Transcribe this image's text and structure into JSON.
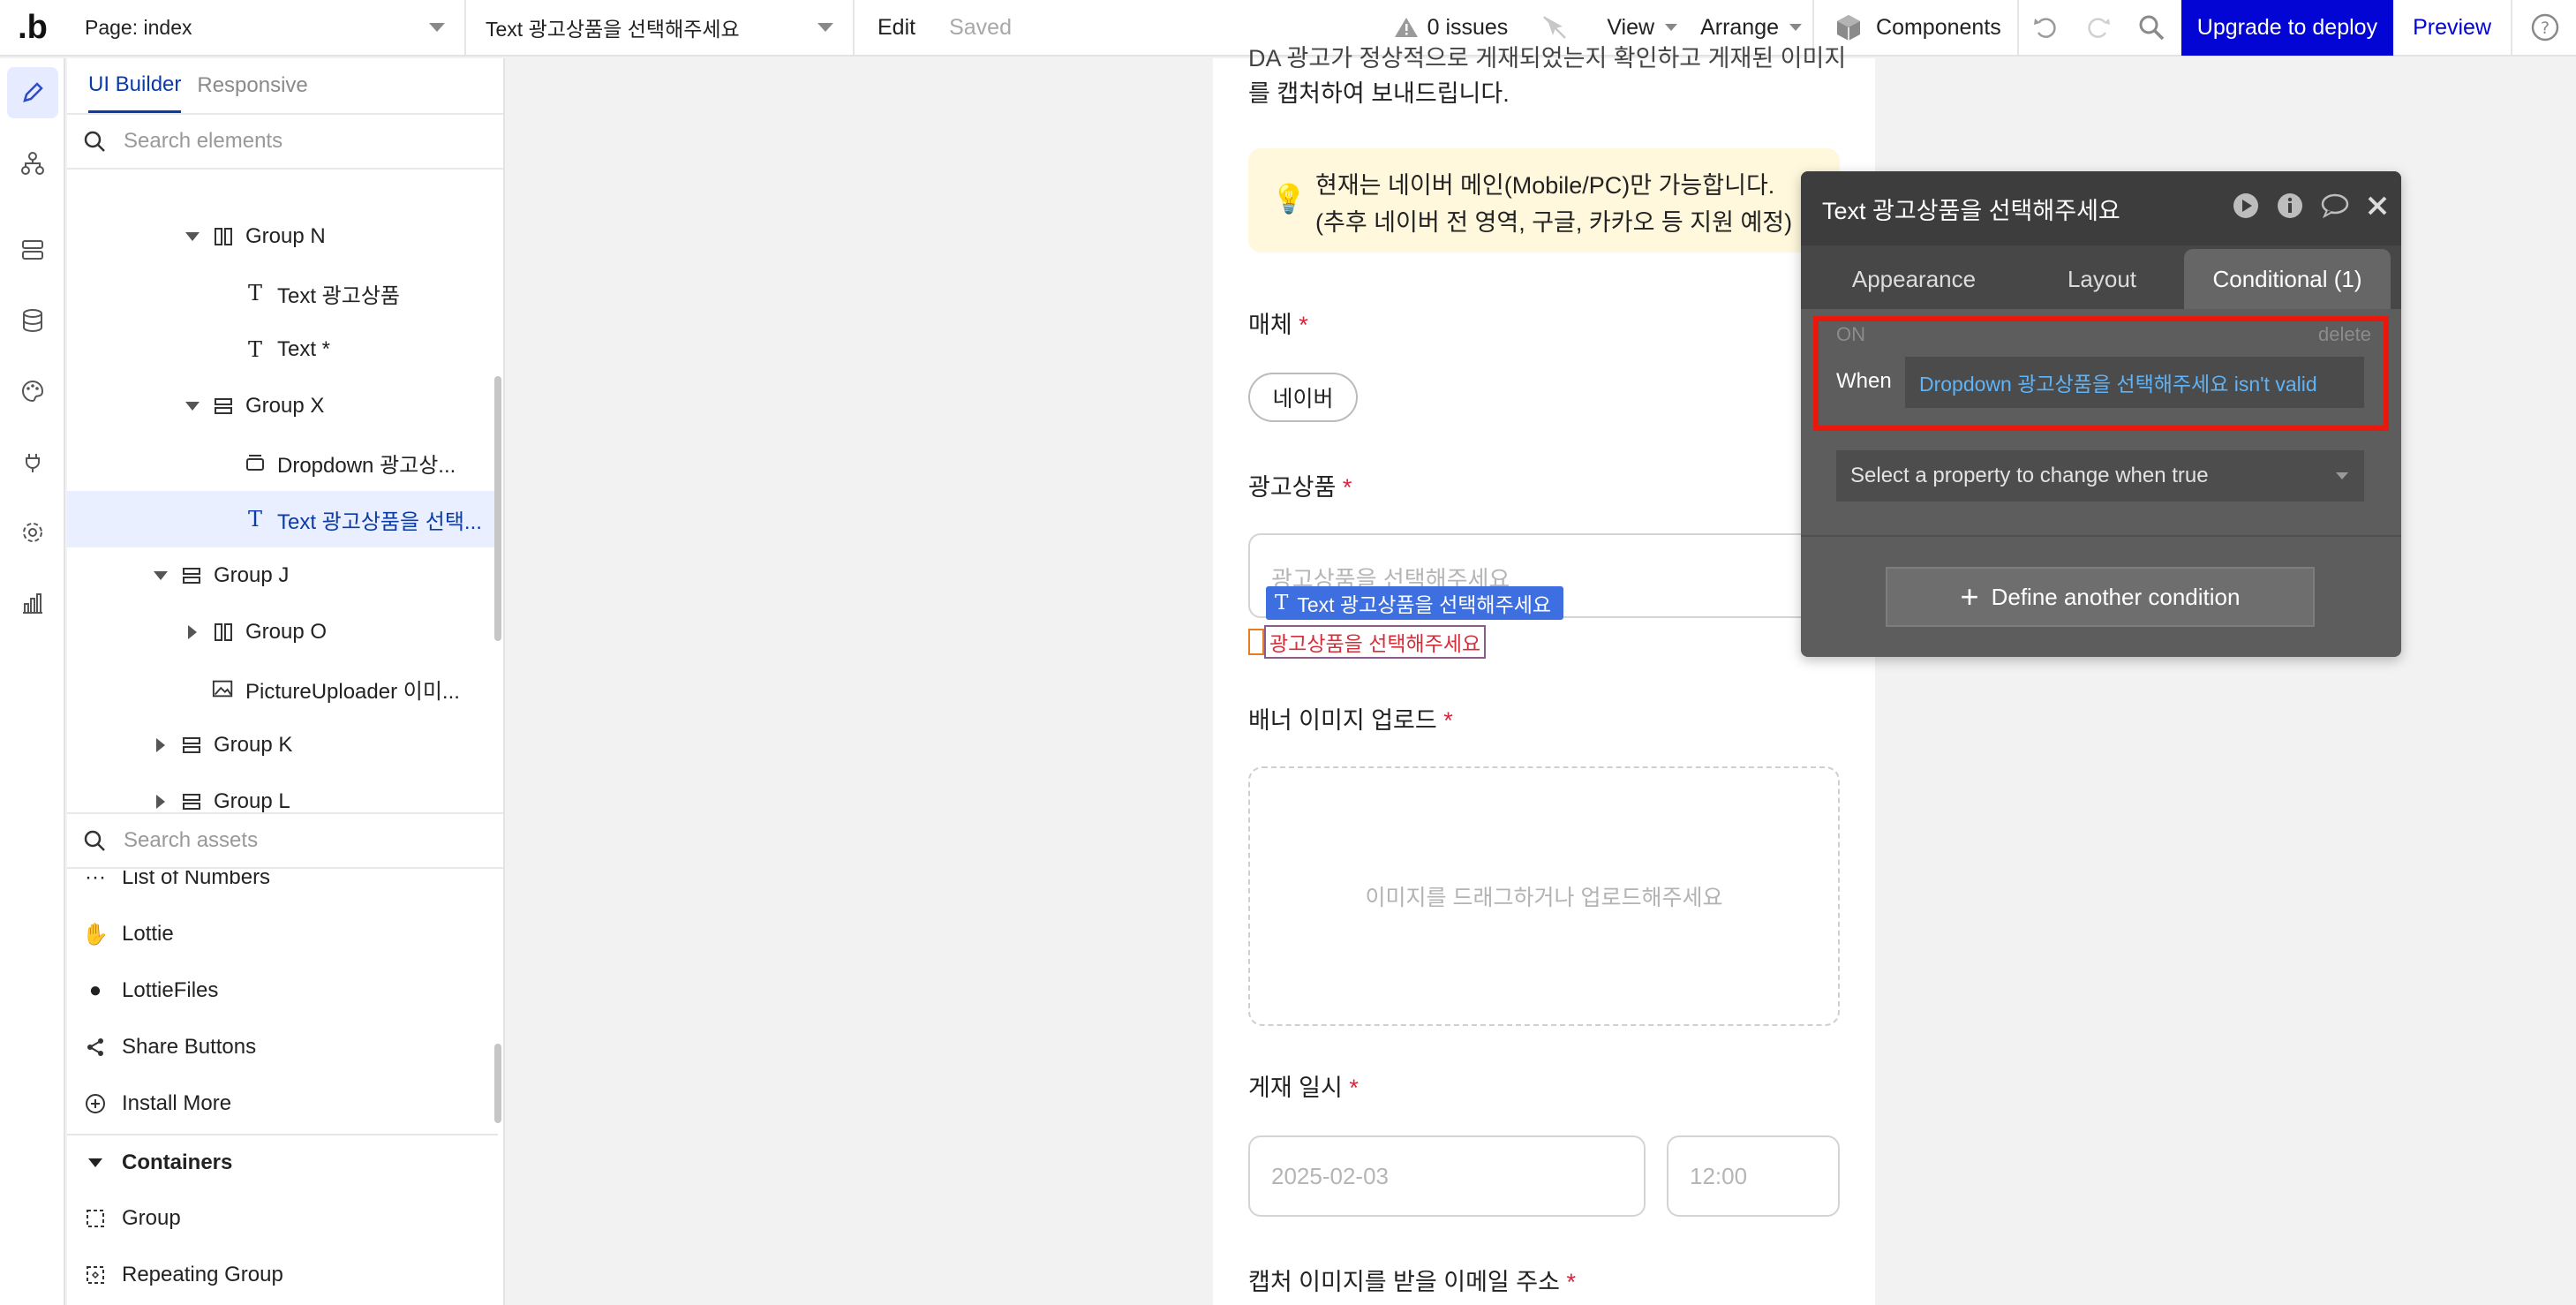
{
  "topbar": {
    "page_select": "Page: index",
    "element_select": "Text 광고상품을 선택해주세요",
    "edit": "Edit",
    "saved": "Saved",
    "issues": "0 issues",
    "view": "View",
    "arrange": "Arrange",
    "components": "Components",
    "upgrade": "Upgrade to deploy",
    "preview": "Preview"
  },
  "left_panel": {
    "tab_ui_builder": "UI Builder",
    "tab_responsive": "Responsive",
    "search_elements_placeholder": "Search elements",
    "tree": [
      {
        "label": "Group N"
      },
      {
        "label": "Text 광고상품"
      },
      {
        "label": "Text *"
      },
      {
        "label": "Group X"
      },
      {
        "label": "Dropdown 광고상..."
      },
      {
        "label": "Text 광고상품을 선택..."
      },
      {
        "label": "Group J"
      },
      {
        "label": "Group O"
      },
      {
        "label": "PictureUploader 이미..."
      },
      {
        "label": "Group K"
      },
      {
        "label": "Group L"
      }
    ],
    "search_assets_placeholder": "Search assets",
    "assets": [
      {
        "label": "List of Numbers"
      },
      {
        "label": "Lottie"
      },
      {
        "label": "LottieFiles"
      },
      {
        "label": "Share Buttons"
      },
      {
        "label": "Install More"
      }
    ],
    "containers_header": "Containers",
    "containers": [
      {
        "label": "Group"
      },
      {
        "label": "Repeating Group"
      }
    ]
  },
  "canvas": {
    "top_text_line1": "DA 광고가 정상적으로 게재되었는지 확인하고 게재된 이미지",
    "top_text_line2": "를 캡처하여 보내드립니다.",
    "notice_line1": "현재는 네이버 메인(Mobile/PC)만 가능합니다.",
    "notice_line2": "(추후 네이버 전 영역, 구글, 카카오 등 지원 예정)",
    "media_label": "매체",
    "media_option": "네이버",
    "product_label": "광고상품",
    "product_placeholder": "광고상품을 선택해주세요",
    "selected_tag": "Text 광고상품을 선택해주세요",
    "error_text": "광고상품을 선택해주세요",
    "banner_label": "배너 이미지 업로드",
    "upload_hint": "이미지를 드래그하거나 업로드해주세요",
    "schedule_label": "게재 일시",
    "date_value": "2025-02-03",
    "time_value": "12:00",
    "email_label": "캡처 이미지를 받을 이메일 주소",
    "required_mark": "*"
  },
  "inspector": {
    "title": "Text 광고상품을 선택해주세요",
    "tab_appearance": "Appearance",
    "tab_layout": "Layout",
    "tab_conditional": "Conditional (1)",
    "on_label": "ON",
    "delete_label": "delete",
    "when_label": "When",
    "when_expression": "Dropdown 광고상품을 선택해주세요 isn't valid",
    "property_select": "Select a property to change when true",
    "define_button": "Define another condition"
  },
  "colors": {
    "accent_blue": "#0205d3",
    "highlight_red": "#e8190c",
    "expression_blue": "#5fb3f6",
    "required_red": "#d7263d"
  }
}
